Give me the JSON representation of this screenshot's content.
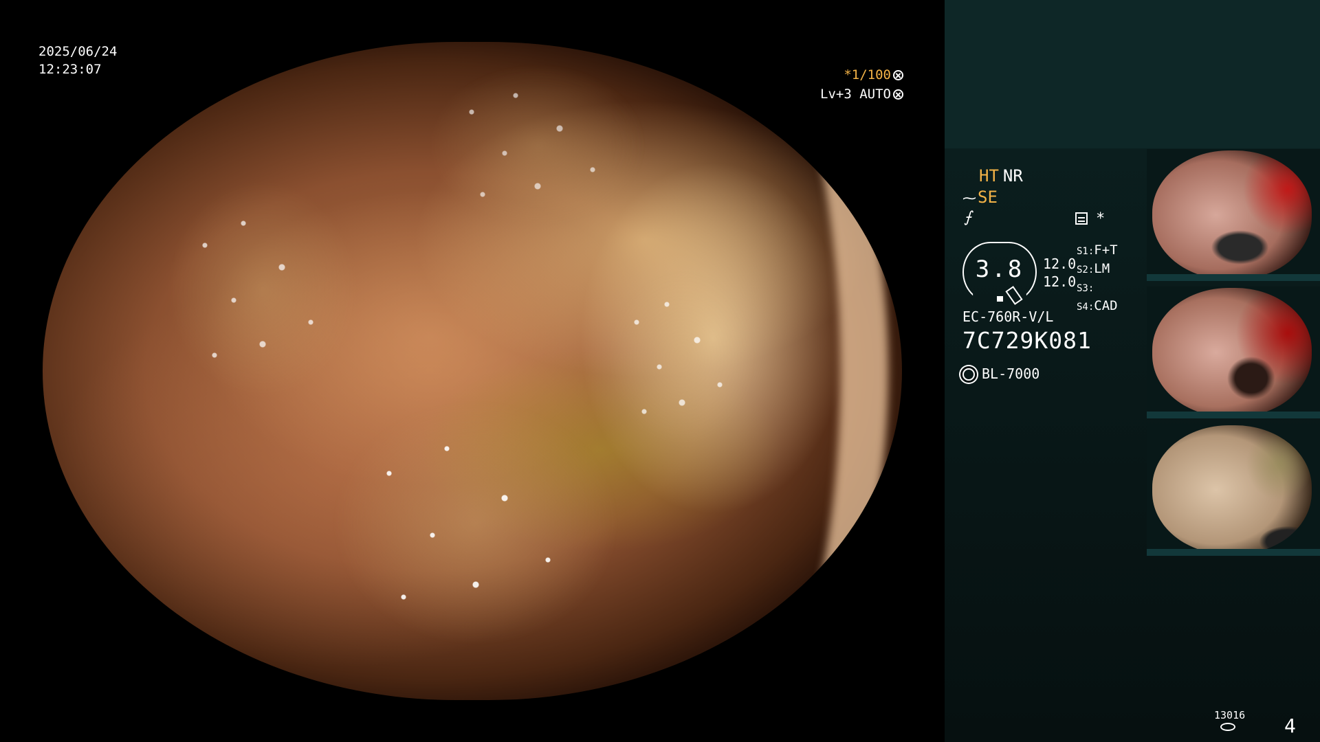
{
  "overlay": {
    "date": "2025/06/24",
    "time": "12:23:07",
    "shutter": "*1/100",
    "level": "Lv+3 AUTO"
  },
  "status": {
    "ht": "HT",
    "nr": "NR",
    "se_symbol": "⁓",
    "se": "SE",
    "f_symbol": "⨍",
    "asterisk": "*"
  },
  "gauge": {
    "value": "3.8",
    "gain1": "12.0",
    "gain2": "12.0"
  },
  "switches": [
    {
      "key": "S1:",
      "value": "F+T"
    },
    {
      "key": "S2:",
      "value": "LM"
    },
    {
      "key": "S3:",
      "value": ""
    },
    {
      "key": "S4:",
      "value": "CAD"
    }
  ],
  "scope": {
    "model": "EC-760R-V/L",
    "serial": "7C729K081",
    "light_source": "BL-7000"
  },
  "footer": {
    "image_count": "13016",
    "page_number": "4"
  },
  "colors": {
    "accent_orange": "#f4b347",
    "panel_top": "#0e2727",
    "panel_body": "#0b1e1e"
  },
  "icons": [
    "shutter-icon",
    "auto-icon",
    "image-setting-icon",
    "light-source-icon",
    "storage-icon"
  ]
}
